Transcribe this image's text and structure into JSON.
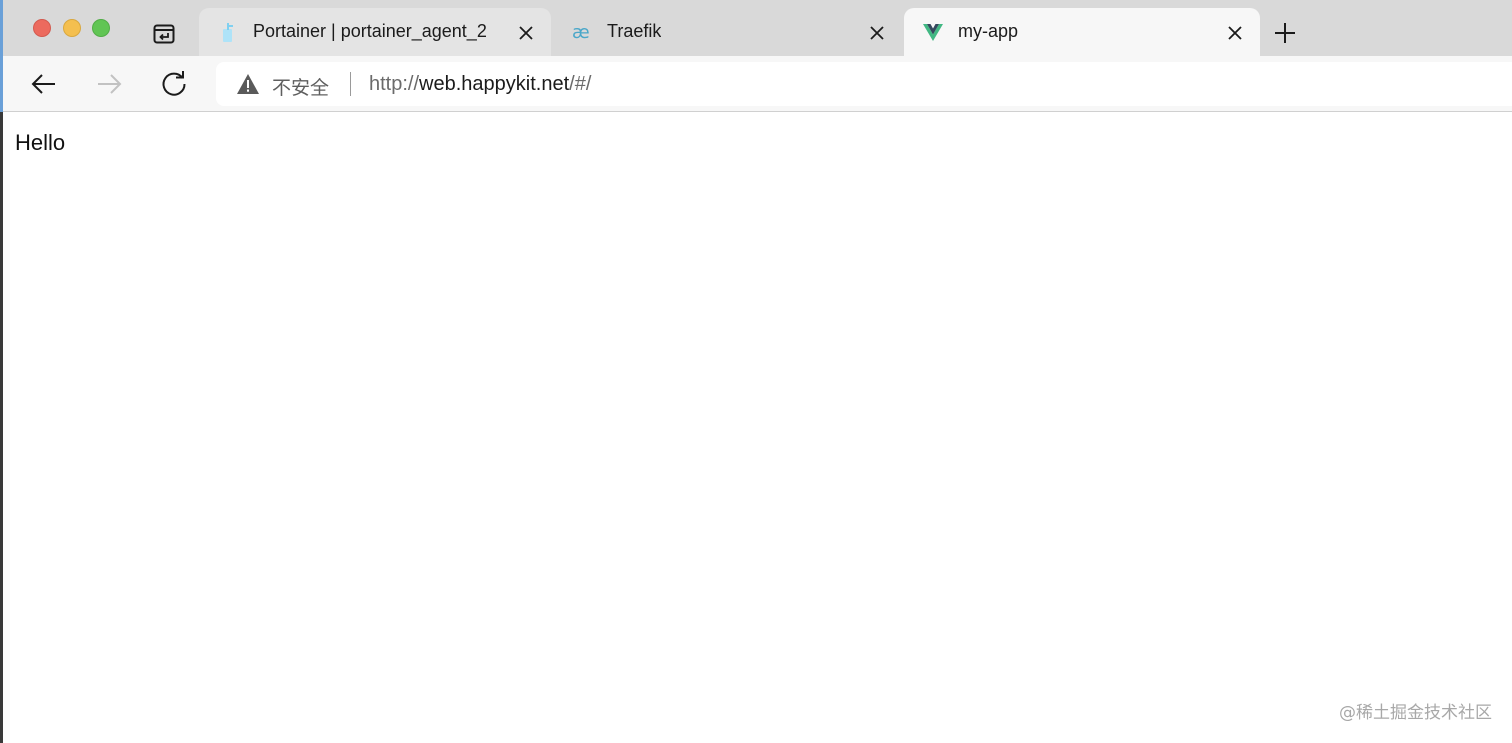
{
  "window": {
    "traffic_lights": {
      "close_color": "#ec6a5e",
      "minimize_color": "#f4bf4f",
      "maximize_color": "#61c554"
    }
  },
  "tabs": [
    {
      "title": "Portainer | portainer_agent_2",
      "icon": "portainer-icon",
      "active": false
    },
    {
      "title": "Traefik",
      "icon": "traefik-icon",
      "active": false
    },
    {
      "title": "my-app",
      "icon": "vue-icon",
      "active": true
    }
  ],
  "toolbar": {
    "security_label": "不安全",
    "url": {
      "scheme": "http://",
      "host": "web.happykit.net",
      "path": "/#/"
    }
  },
  "page": {
    "text": "Hello"
  },
  "watermark": "@稀土掘金技术社区"
}
